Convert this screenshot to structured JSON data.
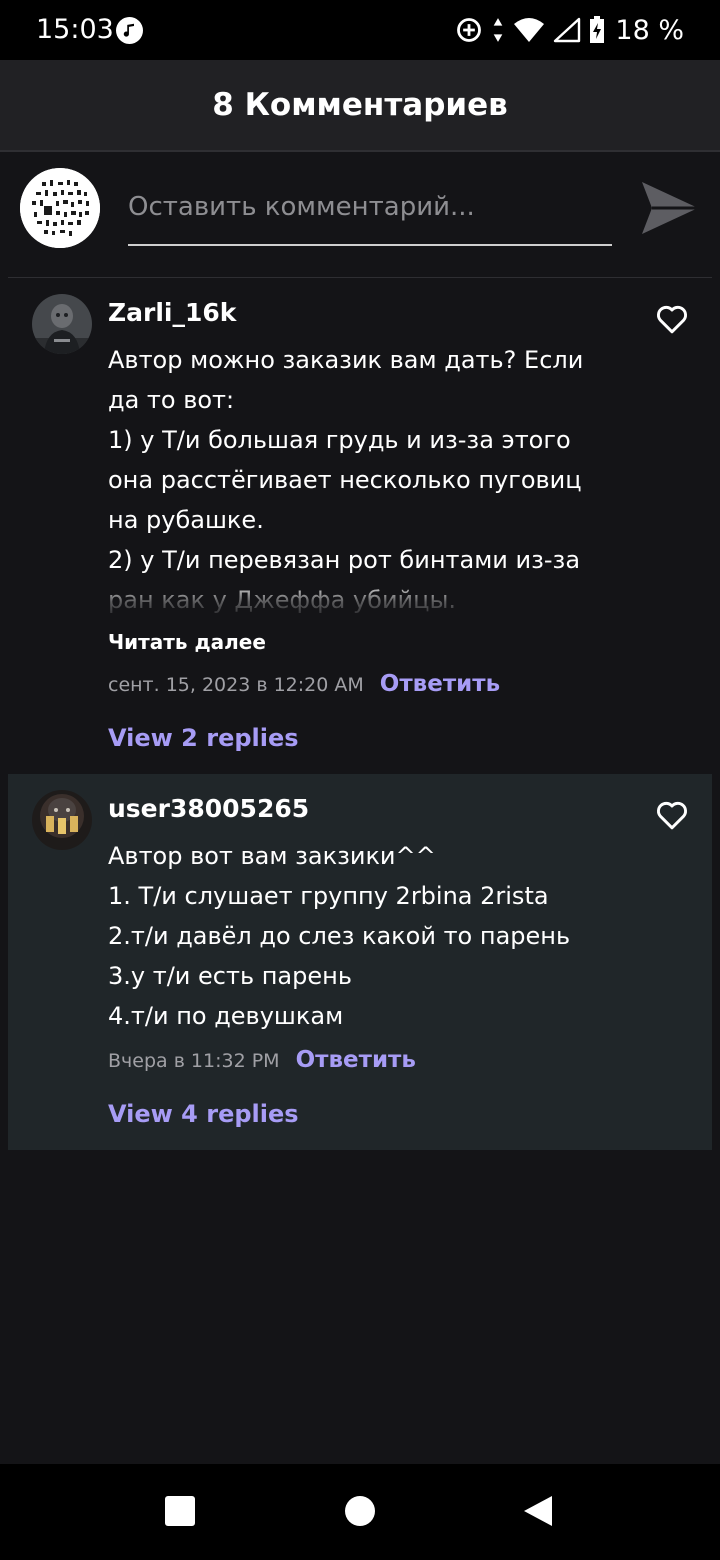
{
  "status_bar": {
    "time": "15:03",
    "battery": "18 %",
    "icons": [
      "music-icon",
      "data-saver-icon",
      "data-arrows-icon",
      "wifi-icon",
      "signal-icon",
      "battery-charging-icon"
    ]
  },
  "header": {
    "title": "8 Комментариев"
  },
  "compose": {
    "placeholder": "Оставить комментарий...",
    "send_icon": "send-icon"
  },
  "comments": [
    {
      "username": "Zarli_16k",
      "lines": [
        "Автор можно заказик вам дать? Если",
        "да то вот:",
        "1) у Т/и большая грудь и из-за этого",
        "она расстёгивает несколько пуговиц",
        "на рубашке.",
        "2) у Т/и перевязан рот бинтами из-за",
        "ран как у Джеффа убийцы."
      ],
      "read_more": "Читать далее",
      "timestamp": "сент. 15, 2023 в 12:20 AM",
      "reply": "Ответить",
      "view_replies": "View 2 replies"
    },
    {
      "username": "user38005265",
      "lines": [
        "Автор вот вам закзики^^",
        "1. Т/и слушает группу 2rbina 2rista",
        "2.т/и давёл до слез какой то парень",
        "3.у т/и есть парень",
        "4.т/и по девушкам"
      ],
      "timestamp": "Вчера в 11:32 PM",
      "reply": "Ответить",
      "view_replies": "View 4 replies"
    }
  ],
  "colors": {
    "background": "#141417",
    "header": "#212124",
    "highlighted_comment": "#202629",
    "accent": "#a79cf5",
    "muted_text": "#a0a0a5"
  }
}
